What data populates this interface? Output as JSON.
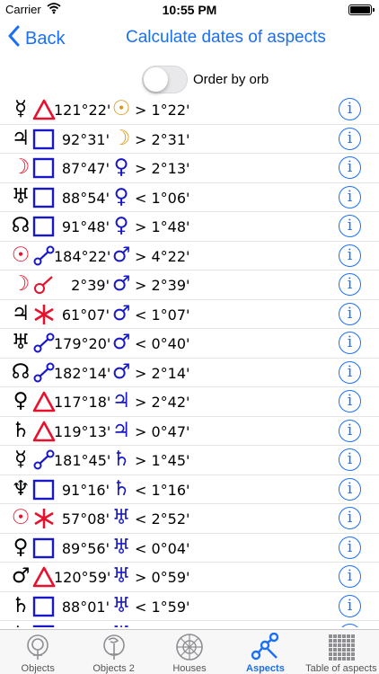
{
  "status_bar": {
    "carrier": "Carrier",
    "time": "10:55 PM"
  },
  "nav": {
    "back_label": "Back",
    "title": "Calculate dates of aspects"
  },
  "toggle": {
    "label": "Order by orb",
    "on": false
  },
  "colors": {
    "accent": "#1a6ff5",
    "red": "#e8112d",
    "blue": "#1818c8",
    "orange": "#e0961e"
  },
  "rows": [
    {
      "p1": "☿",
      "p1_color": "#000000",
      "aspect": "trine",
      "angle": "121°22'",
      "p2": "☉",
      "p2_color": "#e0961e",
      "orb": "> 1°22'"
    },
    {
      "p1": "♃",
      "p1_color": "#000000",
      "aspect": "square",
      "angle": "92°31'",
      "p2": "☽",
      "p2_color": "#e0961e",
      "orb": "> 2°31'"
    },
    {
      "p1": "☽",
      "p1_color": "#e8112d",
      "aspect": "square",
      "angle": "87°47'",
      "p2": "♀",
      "p2_color": "#1818c8",
      "orb": "> 2°13'"
    },
    {
      "p1": "♅",
      "p1_color": "#000000",
      "aspect": "square",
      "angle": "88°54'",
      "p2": "♀",
      "p2_color": "#1818c8",
      "orb": "< 1°06'"
    },
    {
      "p1": "☊",
      "p1_color": "#000000",
      "aspect": "square",
      "angle": "91°48'",
      "p2": "♀",
      "p2_color": "#1818c8",
      "orb": "> 1°48'"
    },
    {
      "p1": "☉",
      "p1_color": "#e8112d",
      "aspect": "opposition",
      "angle": "184°22'",
      "p2": "♂",
      "p2_color": "#1818c8",
      "orb": "> 4°22'"
    },
    {
      "p1": "☽",
      "p1_color": "#e8112d",
      "aspect": "conjunction",
      "angle": "2°39'",
      "p2": "♂",
      "p2_color": "#1818c8",
      "orb": "> 2°39'"
    },
    {
      "p1": "♃",
      "p1_color": "#000000",
      "aspect": "sextile",
      "angle": "61°07'",
      "p2": "♂",
      "p2_color": "#1818c8",
      "orb": "< 1°07'"
    },
    {
      "p1": "♅",
      "p1_color": "#000000",
      "aspect": "opposition",
      "angle": "179°20'",
      "p2": "♂",
      "p2_color": "#1818c8",
      "orb": "< 0°40'"
    },
    {
      "p1": "☊",
      "p1_color": "#000000",
      "aspect": "opposition",
      "angle": "182°14'",
      "p2": "♂",
      "p2_color": "#1818c8",
      "orb": "> 2°14'"
    },
    {
      "p1": "♀",
      "p1_color": "#000000",
      "aspect": "trine",
      "angle": "117°18'",
      "p2": "♃",
      "p2_color": "#1818c8",
      "orb": "> 2°42'"
    },
    {
      "p1": "♄",
      "p1_color": "#000000",
      "aspect": "trine",
      "angle": "119°13'",
      "p2": "♃",
      "p2_color": "#1818c8",
      "orb": "> 0°47'"
    },
    {
      "p1": "☿",
      "p1_color": "#000000",
      "aspect": "opposition",
      "angle": "181°45'",
      "p2": "♄",
      "p2_color": "#1818c8",
      "orb": "> 1°45'"
    },
    {
      "p1": "♆",
      "p1_color": "#000000",
      "aspect": "square",
      "angle": "91°16'",
      "p2": "♄",
      "p2_color": "#1818c8",
      "orb": "< 1°16'"
    },
    {
      "p1": "☉",
      "p1_color": "#e8112d",
      "aspect": "sextile",
      "angle": "57°08'",
      "p2": "♅",
      "p2_color": "#1818c8",
      "orb": "< 2°52'"
    },
    {
      "p1": "♀",
      "p1_color": "#000000",
      "aspect": "square",
      "angle": "89°56'",
      "p2": "♅",
      "p2_color": "#1818c8",
      "orb": "< 0°04'"
    },
    {
      "p1": "♂",
      "p1_color": "#000000",
      "aspect": "trine",
      "angle": "120°59'",
      "p2": "♅",
      "p2_color": "#1818c8",
      "orb": "> 0°59'"
    },
    {
      "p1": "♄",
      "p1_color": "#000000",
      "aspect": "square",
      "angle": "88°01'",
      "p2": "♅",
      "p2_color": "#1818c8",
      "orb": "< 1°59'"
    },
    {
      "p1": "♄",
      "p1_color": "#000000",
      "aspect": "square",
      "angle": "",
      "p2": "♅",
      "p2_color": "#1818c8",
      "orb": ""
    }
  ],
  "tabs": [
    {
      "label": "Objects",
      "icon": "objects-icon",
      "active": false
    },
    {
      "label": "Objects 2",
      "icon": "objects-2-icon",
      "active": false
    },
    {
      "label": "Houses",
      "icon": "houses-wheel-icon",
      "active": false
    },
    {
      "label": "Aspects",
      "icon": "aspects-icon",
      "active": true
    },
    {
      "label": "Table of aspects",
      "icon": "table-grid-icon",
      "active": false
    }
  ]
}
